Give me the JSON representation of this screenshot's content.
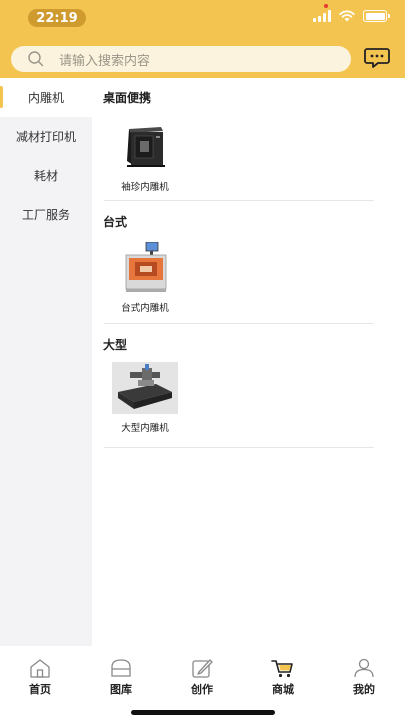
{
  "status_bar": {
    "time": "22:19"
  },
  "search": {
    "placeholder": "请输入搜索内容"
  },
  "sidebar": {
    "items": [
      {
        "label": "内雕机",
        "active": true
      },
      {
        "label": "减材打印机",
        "active": false
      },
      {
        "label": "耗材",
        "active": false
      },
      {
        "label": "工厂服务",
        "active": false
      }
    ]
  },
  "sections": [
    {
      "title": "桌面便携",
      "products": [
        {
          "name": "袖珍内雕机"
        }
      ]
    },
    {
      "title": "台式",
      "products": [
        {
          "name": "台式内雕机"
        }
      ]
    },
    {
      "title": "大型",
      "products": [
        {
          "name": "大型内雕机"
        }
      ]
    }
  ],
  "tabbar": {
    "items": [
      {
        "label": "首页",
        "icon": "home-icon"
      },
      {
        "label": "图库",
        "icon": "gallery-icon"
      },
      {
        "label": "创作",
        "icon": "create-icon"
      },
      {
        "label": "商城",
        "icon": "cart-icon"
      },
      {
        "label": "我的",
        "icon": "profile-icon"
      }
    ]
  },
  "colors": {
    "accent": "#F3C550",
    "time_pill": "#CF9A2E",
    "sidebar_bg": "#F3F3F5"
  }
}
